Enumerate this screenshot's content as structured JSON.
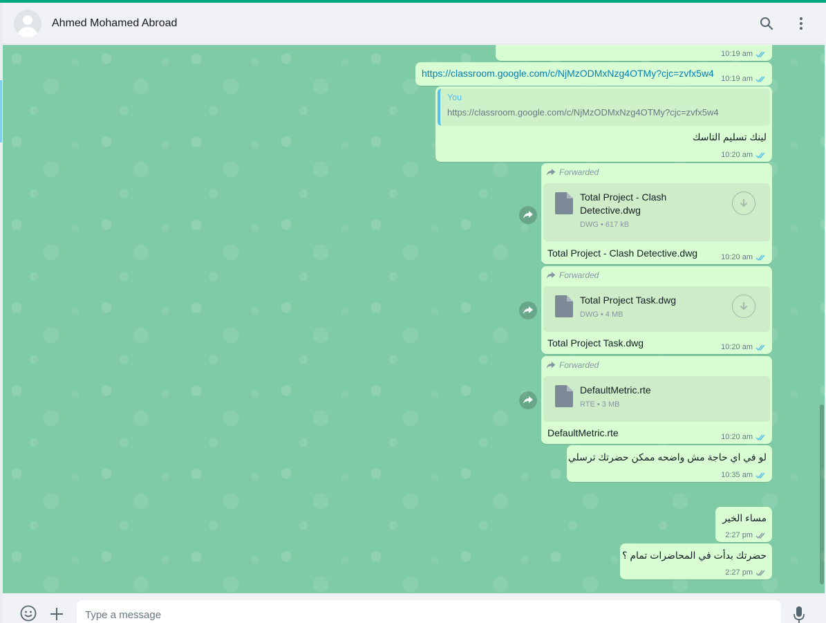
{
  "header": {
    "contact_name": "Ahmed Mohamed Abroad",
    "icons": [
      "default-avatar-icon",
      "search-icon",
      "menu-icon"
    ]
  },
  "messages": [
    {
      "type": "partial",
      "time": "10:19 am",
      "status": "read"
    },
    {
      "type": "link",
      "text": "https://classroom.google.com/c/NjMzODMxNzg4OTMy?cjc=zvfx5w4",
      "time": "10:19 am",
      "status": "read"
    },
    {
      "type": "reply",
      "quote_author": "You",
      "quote_text": "https://classroom.google.com/c/NjMzODMxNzg4OTMy?cjc=zvfx5w4",
      "text": "لينك تسليم التاسك",
      "time": "10:20 am",
      "status": "read"
    },
    {
      "type": "document",
      "forwarded_label": "Forwarded",
      "file_name": "Total Project - Clash Detective.dwg",
      "file_type": "DWG",
      "file_size": "617 kB",
      "file_info": "DWG • 617 kB",
      "caption": "Total Project - Clash Detective.dwg",
      "time": "10:20 am",
      "status": "read"
    },
    {
      "type": "document",
      "forwarded_label": "Forwarded",
      "file_name": "Total Project Task.dwg",
      "file_type": "DWG",
      "file_size": "4 MB",
      "file_info": "DWG • 4 MB",
      "caption": "Total Project Task.dwg",
      "time": "10:20 am",
      "status": "read"
    },
    {
      "type": "document",
      "forwarded_label": "Forwarded",
      "file_name": "DefaultMetric.rte",
      "file_type": "RTE",
      "file_size": "3 MB",
      "file_info": "RTE • 3 MB",
      "caption": "DefaultMetric.rte",
      "time": "10:20 am",
      "status": "read"
    },
    {
      "type": "text",
      "text": "لو في اي حاجة مش واضحه ممكن حضرتك ترسلي",
      "time": "10:35 am",
      "status": "read"
    },
    {
      "type": "text",
      "text": "مساء الخير",
      "time": "2:27 pm",
      "status": "delivered"
    },
    {
      "type": "text",
      "text": "حضرتك بدأت في المحاضرات تمام ؟",
      "time": "2:27 pm",
      "status": "delivered"
    }
  ],
  "composer": {
    "placeholder": "Type a message",
    "icons": [
      "emoji-icon",
      "attach-plus-icon",
      "microphone-icon"
    ]
  },
  "colors": {
    "accent": "#00a884",
    "outgoing_bubble": "#d9fdd3",
    "chat_background": "#7fcba6",
    "read_tick": "#53bdeb",
    "link": "#027eb5"
  }
}
